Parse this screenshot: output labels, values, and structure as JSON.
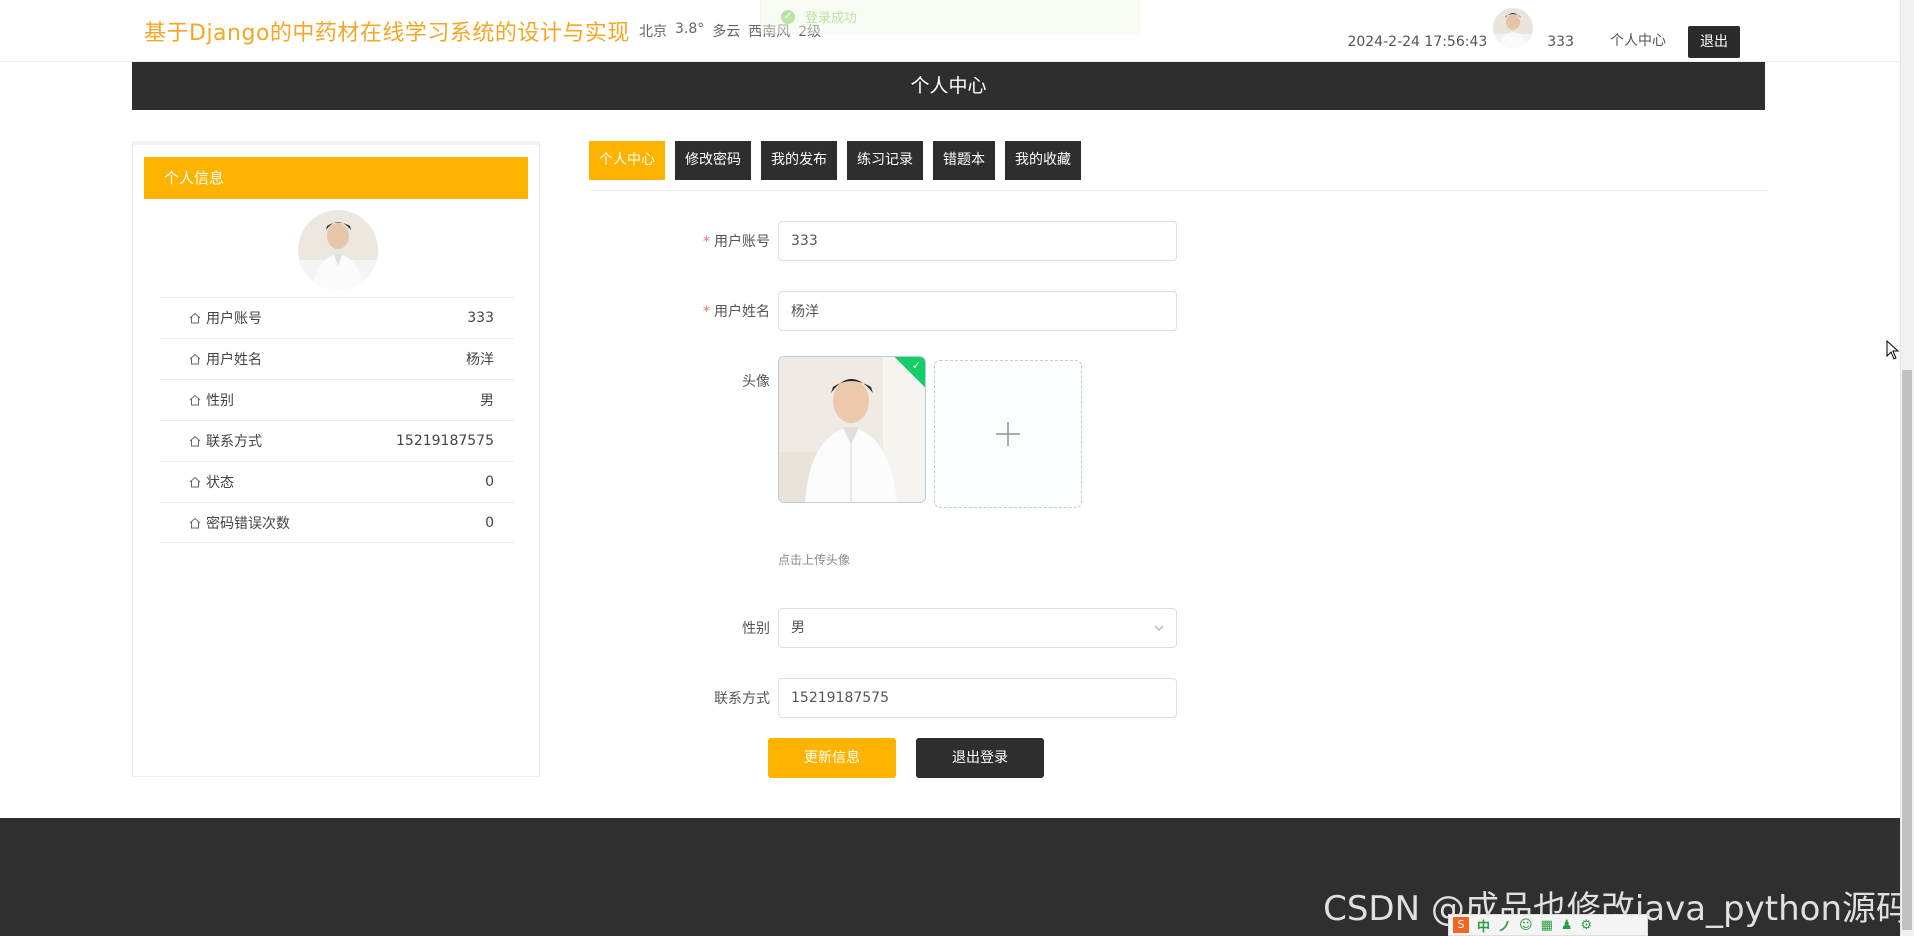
{
  "header": {
    "site_title": "基于Django的中药材在线学习系统的设计与实现",
    "weather": {
      "city": "北京",
      "temperature": "3.8°",
      "condition": "多云",
      "wind": "西南风",
      "level": "2级"
    },
    "toast_text": "登录成功",
    "datetime": "2024-2-24 17:56:43",
    "username": "333",
    "personal_center_link": "个人中心",
    "logout_label": "退出"
  },
  "title_bar": "个人中心",
  "info_card": {
    "header": "个人信息",
    "rows": [
      {
        "label": "用户账号",
        "value": "333"
      },
      {
        "label": "用户姓名",
        "value": "杨洋"
      },
      {
        "label": "性别",
        "value": "男"
      },
      {
        "label": "联系方式",
        "value": "15219187575"
      },
      {
        "label": "状态",
        "value": "0"
      },
      {
        "label": "密码错误次数",
        "value": "0"
      }
    ]
  },
  "tabs": [
    {
      "label": "个人中心",
      "active": true
    },
    {
      "label": "修改密码",
      "active": false
    },
    {
      "label": "我的发布",
      "active": false
    },
    {
      "label": "练习记录",
      "active": false
    },
    {
      "label": "错题本",
      "active": false
    },
    {
      "label": "我的收藏",
      "active": false
    }
  ],
  "form": {
    "account_label": "用户账号",
    "account_value": "333",
    "name_label": "用户姓名",
    "name_value": "杨洋",
    "avatar_label": "头像",
    "upload_tip": "点击上传头像",
    "gender_label": "性别",
    "gender_value": "男",
    "phone_label": "联系方式",
    "phone_value": "15219187575",
    "update_button": "更新信息",
    "logout_button": "退出登录",
    "required_mark": "*"
  },
  "footer": {
    "watermark": "CSDN @成品也修改java_python源码"
  },
  "ime": {
    "logo": "S",
    "glyphs": [
      "中",
      "ノ",
      "☺",
      "▦",
      "♟",
      "⚙"
    ]
  },
  "colors": {
    "accent": "#fdb300",
    "title": "#f5a623",
    "dark": "#2e2e2e",
    "success": "#13ce66"
  }
}
